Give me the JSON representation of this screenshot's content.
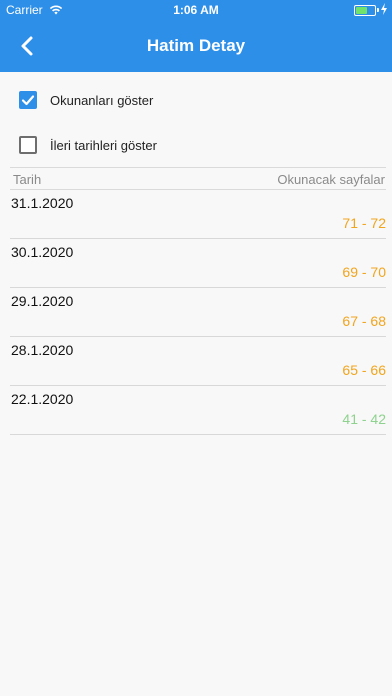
{
  "status_bar": {
    "carrier": "Carrier",
    "time": "1:06 AM",
    "battery_color": "#6fe36b"
  },
  "nav": {
    "title": "Hatim Detay",
    "back_icon": "chevron-left-icon",
    "background": "#2e8fe9"
  },
  "options": [
    {
      "label": "Okunanları göster",
      "checked": true
    },
    {
      "label": "İleri tarihleri göster",
      "checked": false
    }
  ],
  "table": {
    "col_date": "Tarih",
    "col_pages": "Okunacak sayfalar",
    "rows": [
      {
        "date": "31.1.2020",
        "pages": "71 - 72",
        "color": "#f1a51d"
      },
      {
        "date": "30.1.2020",
        "pages": "69 - 70",
        "color": "#f1a51d"
      },
      {
        "date": "29.1.2020",
        "pages": "67 - 68",
        "color": "#f1a51d"
      },
      {
        "date": "28.1.2020",
        "pages": "65 - 66",
        "color": "#f1a51d"
      },
      {
        "date": "22.1.2020",
        "pages": "41 - 42",
        "color": "#8fd18f"
      }
    ]
  }
}
